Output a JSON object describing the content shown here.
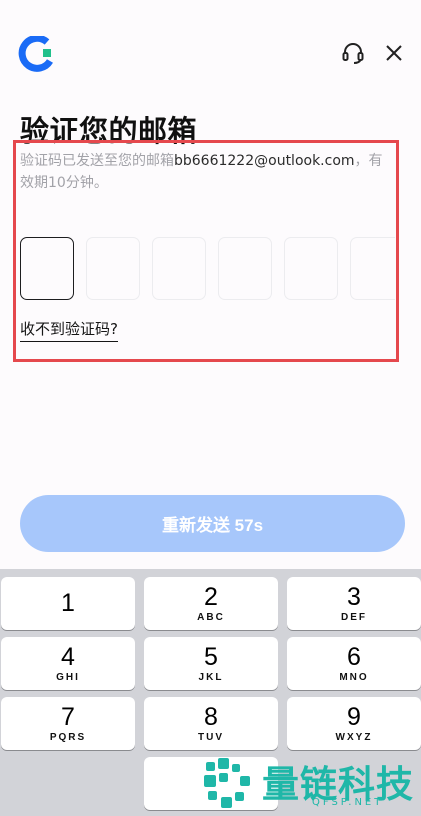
{
  "header": {
    "logo_icon": "app-logo-icon",
    "support_icon": "headset-support-icon",
    "close_icon": "close-icon"
  },
  "title": "验证您的邮箱",
  "description": {
    "prefix": "验证码已发送至您的邮箱",
    "email": "bb6661222@outlook.com",
    "suffix": "，有效期10分钟。"
  },
  "code_boxes": [
    "",
    "",
    "",
    "",
    "",
    ""
  ],
  "resend_link": "收不到验证码?",
  "resend_button": "重新发送 57s",
  "keyboard": {
    "keys": [
      {
        "digit": "1",
        "letters": ""
      },
      {
        "digit": "2",
        "letters": "ABC"
      },
      {
        "digit": "3",
        "letters": "DEF"
      },
      {
        "digit": "4",
        "letters": "GHI"
      },
      {
        "digit": "5",
        "letters": "JKL"
      },
      {
        "digit": "6",
        "letters": "MNO"
      },
      {
        "digit": "7",
        "letters": "PQRS"
      },
      {
        "digit": "8",
        "letters": "TUV"
      },
      {
        "digit": "9",
        "letters": "WXYZ"
      },
      {
        "digit": "",
        "letters": ""
      }
    ]
  },
  "watermark": {
    "text": "量链科技",
    "sub": "QFSP.NET"
  },
  "colors": {
    "accent": "#1a6bf6",
    "button_disabled": "#a7c7fb",
    "highlight": "#e5484d"
  }
}
